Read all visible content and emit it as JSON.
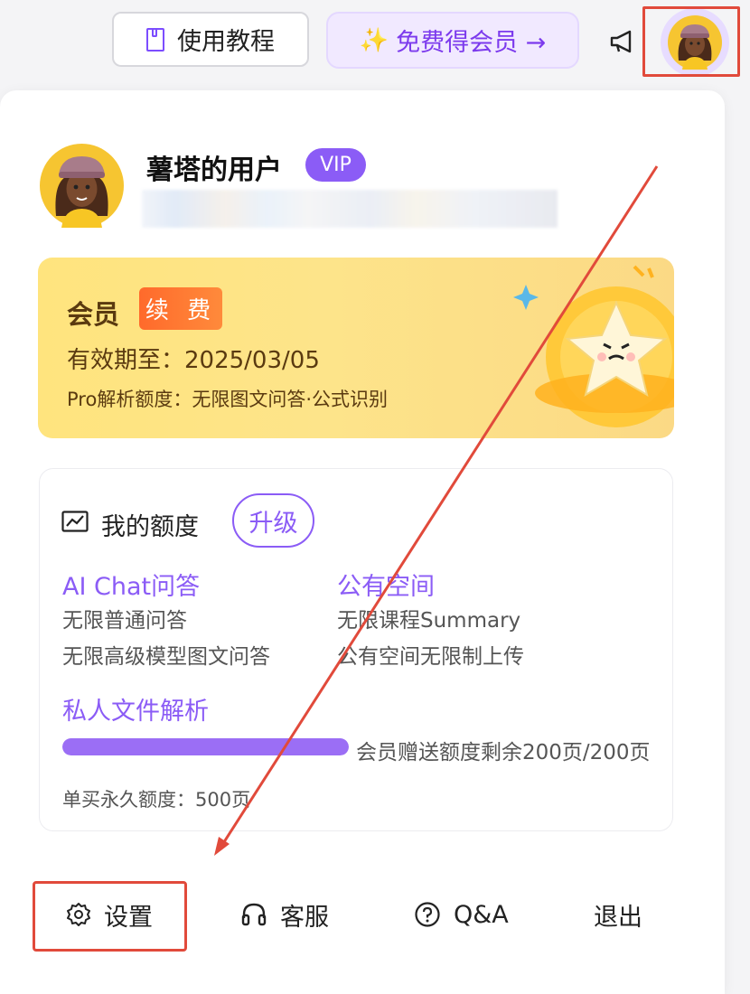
{
  "header": {
    "tutorial_label": "使用教程",
    "free_member_label": "免费得会员 →",
    "spark_glyph": "✨"
  },
  "user": {
    "name": "薯塔的用户",
    "badge": "VIP"
  },
  "membership": {
    "title": "会员",
    "renew_label": "续 费",
    "expire_text": "有效期至：2025/03/05",
    "pro_text": "Pro解析额度：无限图文问答·公式识别"
  },
  "quota": {
    "title": "我的额度",
    "upgrade_label": "升级",
    "ai_chat": {
      "title": "AI Chat问答",
      "lines": [
        "无限普通问答",
        "无限高级模型图文问答"
      ]
    },
    "public_space": {
      "title": "公有空间",
      "lines": [
        "无限课程Summary",
        "公有空间无限制上传"
      ]
    },
    "private_files": {
      "title": "私人文件解析",
      "progress_fraction": 1.0,
      "progress_text": "会员赠送额度剩余200页/200页",
      "permanent_text": "单买永久额度：500页"
    }
  },
  "footer": {
    "settings_label": "设置",
    "support_label": "客服",
    "qa_label": "Q&A",
    "logout_label": "退出"
  },
  "colors": {
    "accent": "#8b5cf6",
    "annotation_red": "#e14a3b",
    "renew_orange": "#ff6a2b"
  }
}
